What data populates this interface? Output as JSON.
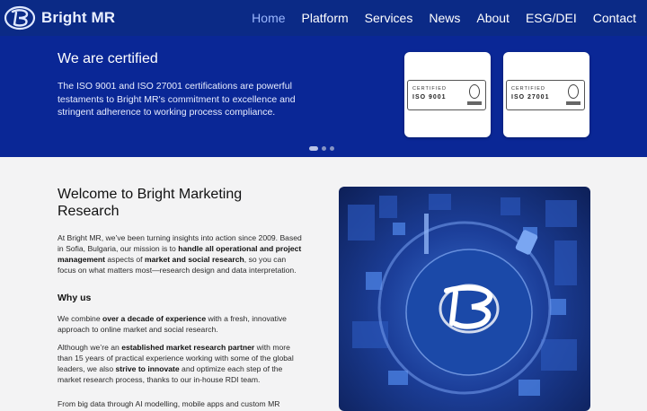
{
  "brand": {
    "name": "Bright MR"
  },
  "nav": {
    "items": [
      {
        "label": "Home",
        "active": true
      },
      {
        "label": "Platform"
      },
      {
        "label": "Services"
      },
      {
        "label": "News"
      },
      {
        "label": "About"
      },
      {
        "label": "ESG/DEI"
      },
      {
        "label": "Contact"
      }
    ]
  },
  "hero": {
    "title": "We are certified",
    "text": "The ISO 9001 and ISO 27001 certifications are powerful testaments to Bright MR's commitment to excellence and stringent adherence to working process compliance.",
    "certs": [
      {
        "line1": "CERTIFIED",
        "line2": "ISO 9001"
      },
      {
        "line1": "CERTIFIED",
        "line2": "ISO 27001"
      }
    ],
    "slides": 3,
    "active_slide": 0
  },
  "content": {
    "heading": "Welcome to Bright Marketing Research",
    "intro": {
      "p1": "At Bright MR, we’ve been turning insights into action since 2009. Based in Sofia, Bulgaria, our mission is to ",
      "b1": "handle all operational and project management",
      "p2": " aspects of ",
      "b2": "market and social research",
      "p3": ", so you can focus on what matters most—research design and data interpretation."
    },
    "why_title": "Why us",
    "why1": {
      "p1": "We combine ",
      "b1": "over a decade of experience",
      "p2": " with a fresh, innovative approach to online market and social research."
    },
    "why2": {
      "p1": "Although we’re an ",
      "b1": "established market research partner",
      "p2": " with more than 15 years of practical experience working with some of the global leaders, we also ",
      "b2": "strive to innovate",
      "p3": " and optimize each step of the market research process, thanks to our in-house RDI team."
    },
    "cut_line": "From big data through AI modelling, mobile apps and custom MR"
  },
  "colors": {
    "nav_bg": "#0b2a86",
    "hero_bg": "#0a2796",
    "active_link": "#9cb8ff"
  }
}
